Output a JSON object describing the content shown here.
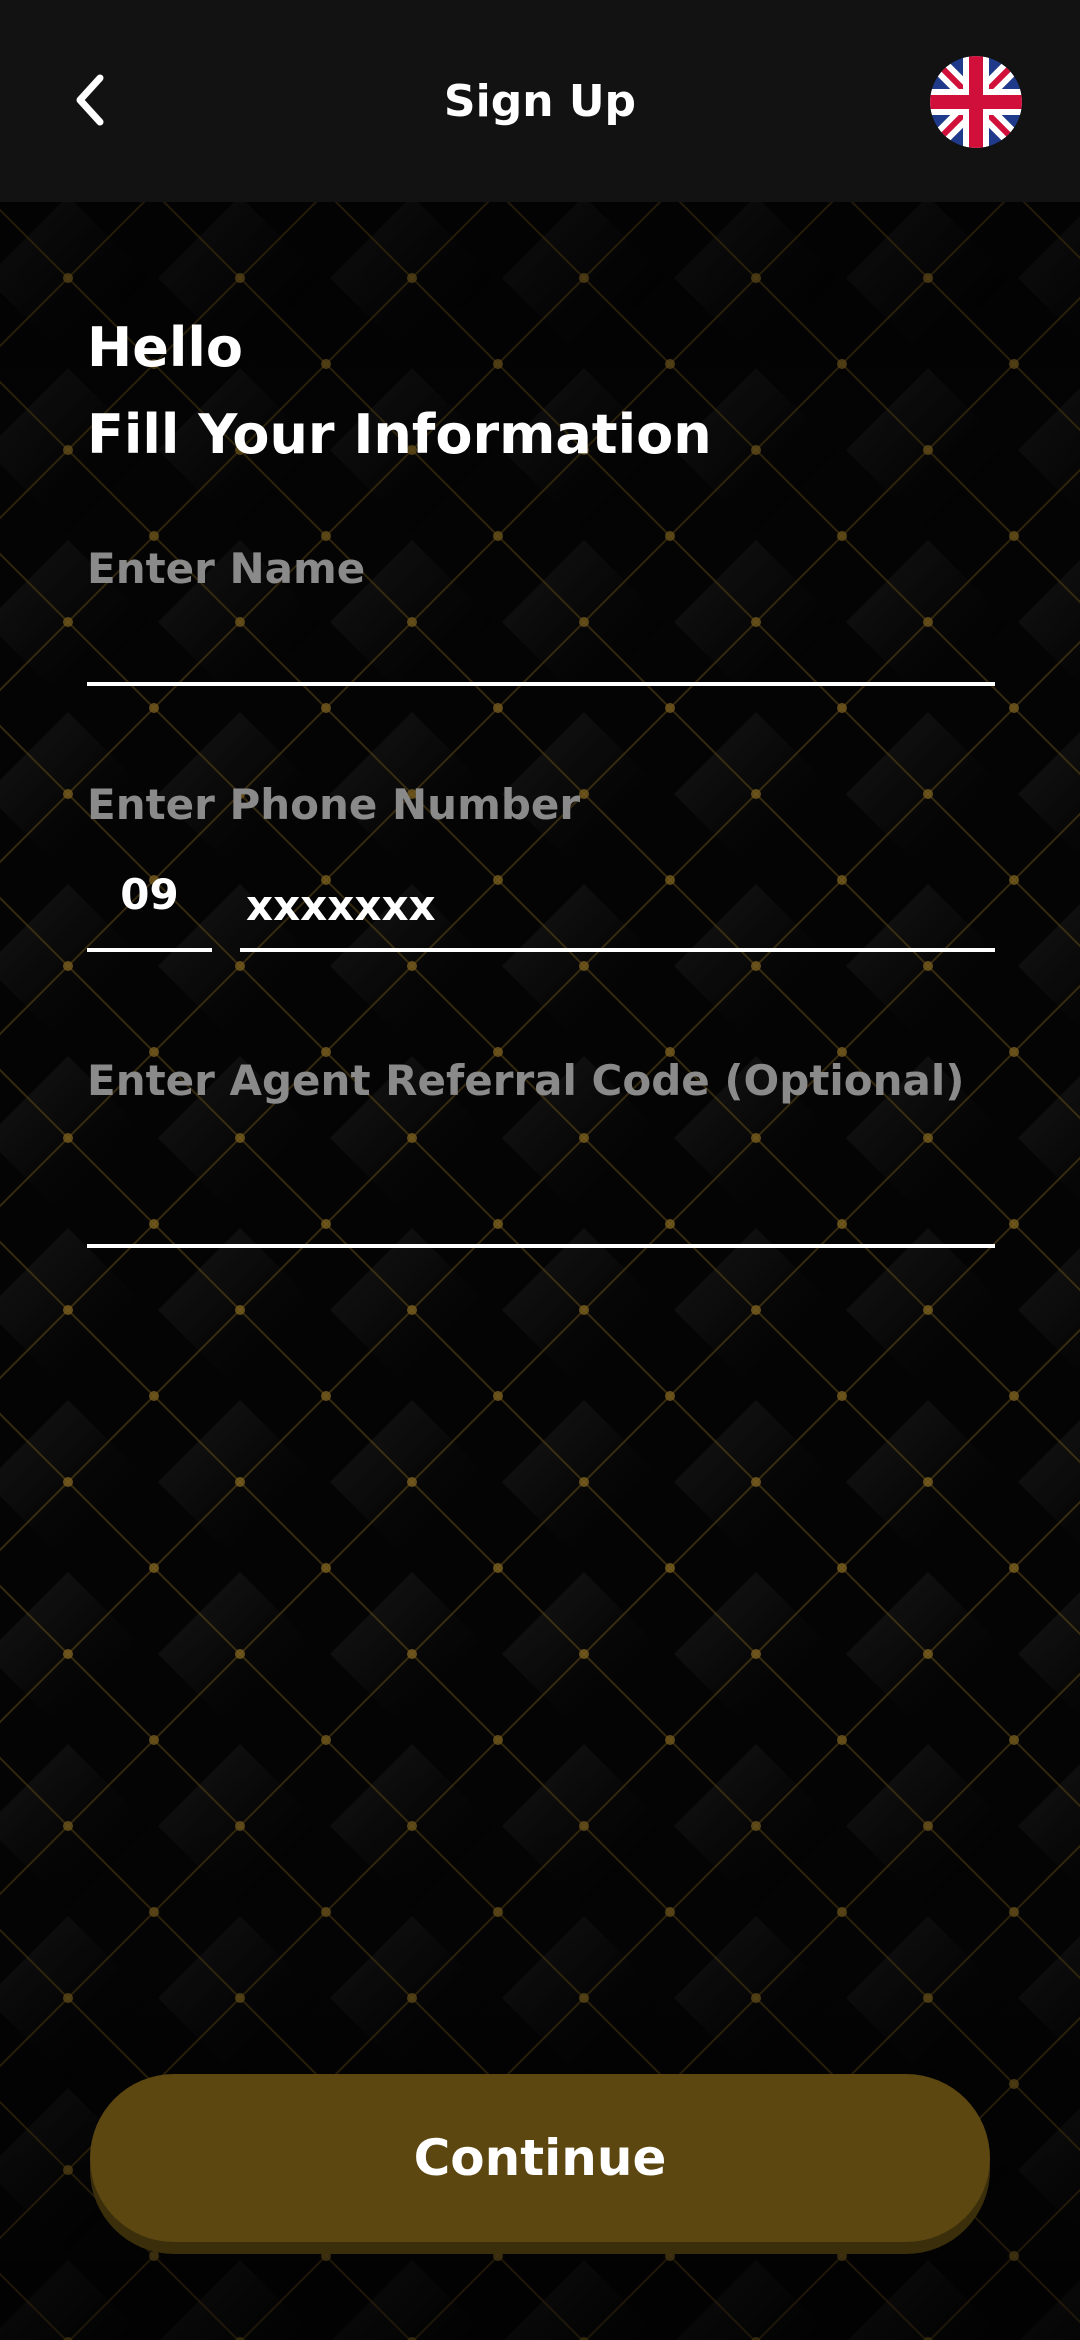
{
  "header": {
    "title": "Sign Up",
    "back_icon": "chevron-left-icon",
    "language_icon": "uk-flag-icon"
  },
  "greeting": {
    "line1": "Hello",
    "line2": "Fill Your Information"
  },
  "form": {
    "name": {
      "label": "Enter Name",
      "value": ""
    },
    "phone": {
      "label": "Enter Phone Number",
      "prefix": "09",
      "placeholder": "xxxxxxx",
      "value": ""
    },
    "referral": {
      "label": "Enter Agent Referral Code (Optional)",
      "value": ""
    }
  },
  "actions": {
    "continue_label": "Continue"
  },
  "colors": {
    "background": "#050505",
    "header": "#121212",
    "accent_gold": "#5c4710",
    "label_gray": "#8a8a8a",
    "pattern_gold": "#8a6a22"
  }
}
